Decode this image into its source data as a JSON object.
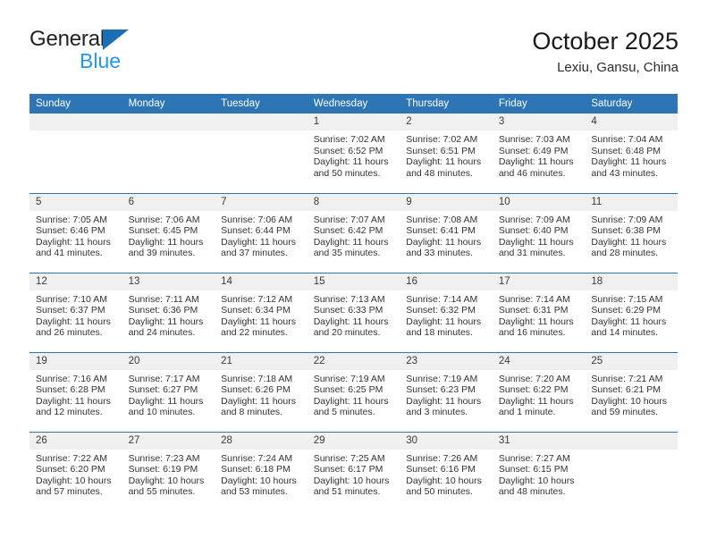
{
  "brand": {
    "name_part1": "General",
    "name_part2": "Blue",
    "logo_icon": "triangle-logo-icon",
    "color_primary": "#1c6fb5",
    "color_secondary": "#2196f3"
  },
  "header": {
    "title": "October 2025",
    "subtitle": "Lexiu, Gansu, China"
  },
  "theme": {
    "header_bg": "#2e75b6",
    "daynum_bg": "#f0f0f0",
    "row_divider": "#2e75b6"
  },
  "calendar": {
    "weekday_headers": [
      "Sunday",
      "Monday",
      "Tuesday",
      "Wednesday",
      "Thursday",
      "Friday",
      "Saturday"
    ],
    "weeks": [
      [
        {
          "day": "",
          "empty": true
        },
        {
          "day": "",
          "empty": true
        },
        {
          "day": "",
          "empty": true
        },
        {
          "day": "1",
          "sunrise": "Sunrise: 7:02 AM",
          "sunset": "Sunset: 6:52 PM",
          "daylight": "Daylight: 11 hours and 50 minutes."
        },
        {
          "day": "2",
          "sunrise": "Sunrise: 7:02 AM",
          "sunset": "Sunset: 6:51 PM",
          "daylight": "Daylight: 11 hours and 48 minutes."
        },
        {
          "day": "3",
          "sunrise": "Sunrise: 7:03 AM",
          "sunset": "Sunset: 6:49 PM",
          "daylight": "Daylight: 11 hours and 46 minutes."
        },
        {
          "day": "4",
          "sunrise": "Sunrise: 7:04 AM",
          "sunset": "Sunset: 6:48 PM",
          "daylight": "Daylight: 11 hours and 43 minutes."
        }
      ],
      [
        {
          "day": "5",
          "sunrise": "Sunrise: 7:05 AM",
          "sunset": "Sunset: 6:46 PM",
          "daylight": "Daylight: 11 hours and 41 minutes."
        },
        {
          "day": "6",
          "sunrise": "Sunrise: 7:06 AM",
          "sunset": "Sunset: 6:45 PM",
          "daylight": "Daylight: 11 hours and 39 minutes."
        },
        {
          "day": "7",
          "sunrise": "Sunrise: 7:06 AM",
          "sunset": "Sunset: 6:44 PM",
          "daylight": "Daylight: 11 hours and 37 minutes."
        },
        {
          "day": "8",
          "sunrise": "Sunrise: 7:07 AM",
          "sunset": "Sunset: 6:42 PM",
          "daylight": "Daylight: 11 hours and 35 minutes."
        },
        {
          "day": "9",
          "sunrise": "Sunrise: 7:08 AM",
          "sunset": "Sunset: 6:41 PM",
          "daylight": "Daylight: 11 hours and 33 minutes."
        },
        {
          "day": "10",
          "sunrise": "Sunrise: 7:09 AM",
          "sunset": "Sunset: 6:40 PM",
          "daylight": "Daylight: 11 hours and 31 minutes."
        },
        {
          "day": "11",
          "sunrise": "Sunrise: 7:09 AM",
          "sunset": "Sunset: 6:38 PM",
          "daylight": "Daylight: 11 hours and 28 minutes."
        }
      ],
      [
        {
          "day": "12",
          "sunrise": "Sunrise: 7:10 AM",
          "sunset": "Sunset: 6:37 PM",
          "daylight": "Daylight: 11 hours and 26 minutes."
        },
        {
          "day": "13",
          "sunrise": "Sunrise: 7:11 AM",
          "sunset": "Sunset: 6:36 PM",
          "daylight": "Daylight: 11 hours and 24 minutes."
        },
        {
          "day": "14",
          "sunrise": "Sunrise: 7:12 AM",
          "sunset": "Sunset: 6:34 PM",
          "daylight": "Daylight: 11 hours and 22 minutes."
        },
        {
          "day": "15",
          "sunrise": "Sunrise: 7:13 AM",
          "sunset": "Sunset: 6:33 PM",
          "daylight": "Daylight: 11 hours and 20 minutes."
        },
        {
          "day": "16",
          "sunrise": "Sunrise: 7:14 AM",
          "sunset": "Sunset: 6:32 PM",
          "daylight": "Daylight: 11 hours and 18 minutes."
        },
        {
          "day": "17",
          "sunrise": "Sunrise: 7:14 AM",
          "sunset": "Sunset: 6:31 PM",
          "daylight": "Daylight: 11 hours and 16 minutes."
        },
        {
          "day": "18",
          "sunrise": "Sunrise: 7:15 AM",
          "sunset": "Sunset: 6:29 PM",
          "daylight": "Daylight: 11 hours and 14 minutes."
        }
      ],
      [
        {
          "day": "19",
          "sunrise": "Sunrise: 7:16 AM",
          "sunset": "Sunset: 6:28 PM",
          "daylight": "Daylight: 11 hours and 12 minutes."
        },
        {
          "day": "20",
          "sunrise": "Sunrise: 7:17 AM",
          "sunset": "Sunset: 6:27 PM",
          "daylight": "Daylight: 11 hours and 10 minutes."
        },
        {
          "day": "21",
          "sunrise": "Sunrise: 7:18 AM",
          "sunset": "Sunset: 6:26 PM",
          "daylight": "Daylight: 11 hours and 8 minutes."
        },
        {
          "day": "22",
          "sunrise": "Sunrise: 7:19 AM",
          "sunset": "Sunset: 6:25 PM",
          "daylight": "Daylight: 11 hours and 5 minutes."
        },
        {
          "day": "23",
          "sunrise": "Sunrise: 7:19 AM",
          "sunset": "Sunset: 6:23 PM",
          "daylight": "Daylight: 11 hours and 3 minutes."
        },
        {
          "day": "24",
          "sunrise": "Sunrise: 7:20 AM",
          "sunset": "Sunset: 6:22 PM",
          "daylight": "Daylight: 11 hours and 1 minute."
        },
        {
          "day": "25",
          "sunrise": "Sunrise: 7:21 AM",
          "sunset": "Sunset: 6:21 PM",
          "daylight": "Daylight: 10 hours and 59 minutes."
        }
      ],
      [
        {
          "day": "26",
          "sunrise": "Sunrise: 7:22 AM",
          "sunset": "Sunset: 6:20 PM",
          "daylight": "Daylight: 10 hours and 57 minutes."
        },
        {
          "day": "27",
          "sunrise": "Sunrise: 7:23 AM",
          "sunset": "Sunset: 6:19 PM",
          "daylight": "Daylight: 10 hours and 55 minutes."
        },
        {
          "day": "28",
          "sunrise": "Sunrise: 7:24 AM",
          "sunset": "Sunset: 6:18 PM",
          "daylight": "Daylight: 10 hours and 53 minutes."
        },
        {
          "day": "29",
          "sunrise": "Sunrise: 7:25 AM",
          "sunset": "Sunset: 6:17 PM",
          "daylight": "Daylight: 10 hours and 51 minutes."
        },
        {
          "day": "30",
          "sunrise": "Sunrise: 7:26 AM",
          "sunset": "Sunset: 6:16 PM",
          "daylight": "Daylight: 10 hours and 50 minutes."
        },
        {
          "day": "31",
          "sunrise": "Sunrise: 7:27 AM",
          "sunset": "Sunset: 6:15 PM",
          "daylight": "Daylight: 10 hours and 48 minutes."
        },
        {
          "day": "",
          "empty": true
        }
      ]
    ]
  }
}
